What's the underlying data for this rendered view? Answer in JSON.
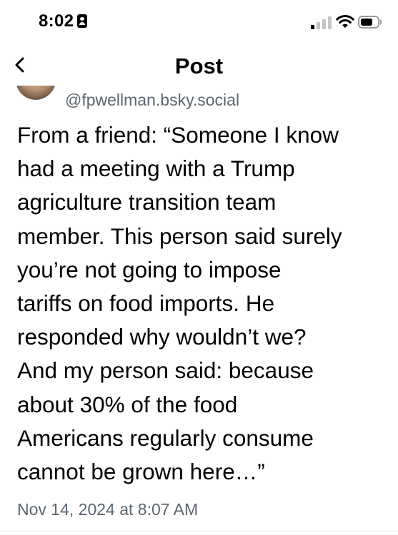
{
  "status_bar": {
    "time": "8:02",
    "icons": [
      "focus-mode-icon",
      "cellular-signal-icon",
      "wifi-icon",
      "battery-icon"
    ]
  },
  "header": {
    "back_icon": "chevron-left-icon",
    "title": "Post"
  },
  "post": {
    "avatar": "avatar",
    "handle": "@fpwellman.bsky.social",
    "text_lines": [
      "From a friend: “Someone I know",
      "had a meeting with a Trump",
      "agriculture transition team",
      "member. This person said surely",
      "you’re not going to impose",
      "tariffs on food imports. He",
      "responded why wouldn’t we?",
      "And my person said: because",
      "about 30% of the food",
      "Americans regularly consume",
      "cannot be grown here…”"
    ],
    "timestamp": "Nov 14, 2024 at 8:07 AM"
  },
  "colors": {
    "background": "#ffffff",
    "text": "#000000",
    "secondary_text": "#5c6670",
    "divider": "#e3e6ea"
  }
}
